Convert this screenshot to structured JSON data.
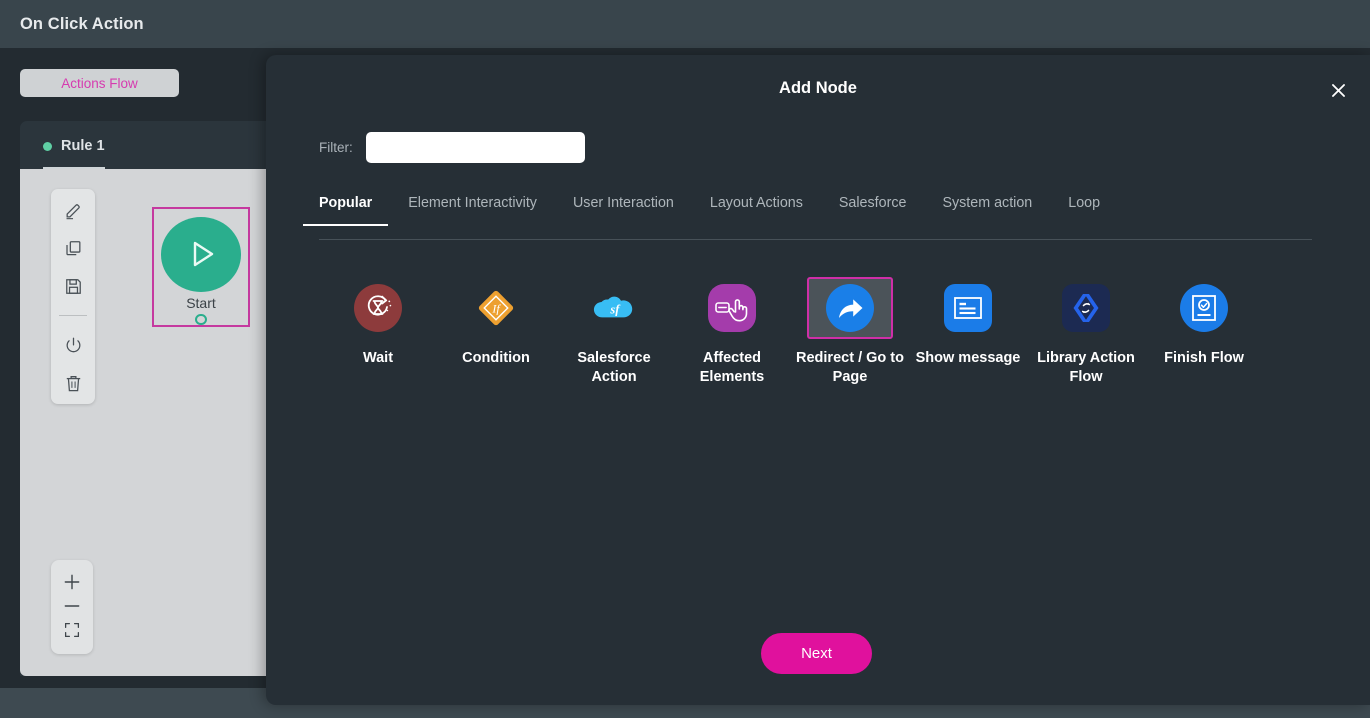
{
  "header": {
    "title": "On Click Action"
  },
  "background_page": {
    "actions_flow_button": "Actions Flow",
    "rule_tab": {
      "label": "Rule 1",
      "status_color": "#5fcfa4"
    },
    "start_node": {
      "label": "Start",
      "selected_border_color": "#c5399f",
      "circle_color": "#2aae8d"
    },
    "toolbar": [
      {
        "name": "edit-icon",
        "title": "Edit"
      },
      {
        "name": "copy-icon",
        "title": "Copy"
      },
      {
        "name": "save-icon",
        "title": "Save"
      },
      {
        "name": "power-icon",
        "title": "Enable / Disable"
      },
      {
        "name": "trash-icon",
        "title": "Delete"
      }
    ],
    "zoom_controls": [
      {
        "name": "zoom-in-icon",
        "title": "Zoom In"
      },
      {
        "name": "zoom-out-icon",
        "title": "Zoom Out"
      },
      {
        "name": "fit-screen-icon",
        "title": "Fit to Screen"
      }
    ]
  },
  "modal": {
    "title": "Add Node",
    "close_label": "✕",
    "filter": {
      "label": "Filter:",
      "value": "",
      "placeholder": ""
    },
    "tabs": [
      {
        "label": "Popular",
        "active": true
      },
      {
        "label": "Element Interactivity",
        "active": false
      },
      {
        "label": "User Interaction",
        "active": false
      },
      {
        "label": "Layout Actions",
        "active": false
      },
      {
        "label": "Salesforce",
        "active": false
      },
      {
        "label": "System action",
        "active": false
      },
      {
        "label": "Loop",
        "active": false
      }
    ],
    "nodes": [
      {
        "label": "Wait",
        "icon": "hourglass-refresh-icon",
        "color": "#8d3b3c",
        "selected": false
      },
      {
        "label": "Condition",
        "icon": "if-diamond-icon",
        "color": "#eda030",
        "selected": false
      },
      {
        "label": "Salesforce Action",
        "icon": "salesforce-cloud-icon",
        "color": "#38bdf4",
        "selected": false
      },
      {
        "label": "Affected Elements",
        "icon": "hand-pointer-icon",
        "color": "#a43cab",
        "selected": false
      },
      {
        "label": "Redirect / Go to Page",
        "icon": "redirect-arrow-icon",
        "color": "#1a7fe8",
        "selected": true
      },
      {
        "label": "Show message",
        "icon": "message-box-icon",
        "color": "#1b7ce8",
        "selected": false
      },
      {
        "label": "Library Action Flow",
        "icon": "code-brackets-icon",
        "color": "#1c2a52",
        "selected": false
      },
      {
        "label": "Finish Flow",
        "icon": "check-document-icon",
        "color": "#1b7ce8",
        "selected": false
      }
    ],
    "next_button": "Next",
    "accent_color": "#e0119d"
  }
}
